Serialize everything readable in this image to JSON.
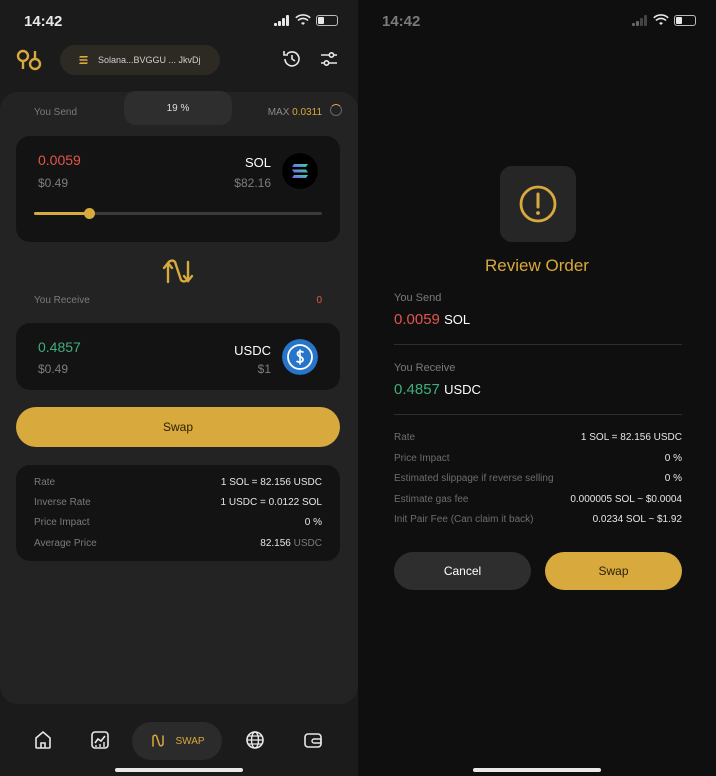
{
  "status": {
    "time": "14:42"
  },
  "left": {
    "wallet_label": "Solana...BVGGU ... JkvDj",
    "you_send_label": "You Send",
    "percent": "19 %",
    "max_label": "MAX",
    "max_value": "0.0311",
    "send": {
      "amount": "0.0059",
      "usd": "$0.49",
      "token": "SOL",
      "price": "$82.16",
      "slider_fraction": 0.19
    },
    "you_receive_label": "You Receive",
    "receive_count": "0",
    "receive": {
      "amount": "0.4857",
      "usd": "$0.49",
      "token": "USDC",
      "price": "$1"
    },
    "swap_button": "Swap",
    "info": {
      "rate_label": "Rate",
      "rate_value": "1 SOL = 82.156 USDC",
      "inverse_label": "Inverse Rate",
      "inverse_value": "1 USDC = 0.0122 SOL",
      "impact_label": "Price Impact",
      "impact_value": "0 %",
      "avg_label": "Average Price",
      "avg_value": "82.156",
      "avg_unit": "USDC"
    },
    "nav": {
      "swap_label": "SWAP"
    }
  },
  "right": {
    "title": "Review Order",
    "you_send_label": "You Send",
    "send_amount": "0.0059",
    "send_token": "SOL",
    "you_receive_label": "You Receive",
    "receive_amount": "0.4857",
    "receive_token": "USDC",
    "rows": [
      {
        "k": "Rate",
        "v": "1 SOL = 82.156 USDC"
      },
      {
        "k": "Price Impact",
        "v": "0 %"
      },
      {
        "k": "Estimated slippage if reverse selling",
        "v": "0 %"
      },
      {
        "k": "Estimate gas fee",
        "v": "0.000005 SOL ~ $0.0004"
      },
      {
        "k": "Init Pair Fee (Can claim it back)",
        "v": "0.0234 SOL ~ $1.92"
      }
    ],
    "cancel_button": "Cancel",
    "swap_button": "Swap"
  },
  "colors": {
    "accent": "#d8a93c",
    "red": "#e2554d",
    "green": "#3fae7c"
  },
  "icons": [
    "logo-icon",
    "solana-icon",
    "history-icon",
    "settings-sliders-icon",
    "swap-arrows-icon",
    "usdc-icon",
    "home-icon",
    "chart-icon",
    "globe-icon",
    "wallet-icon",
    "warning-icon"
  ]
}
